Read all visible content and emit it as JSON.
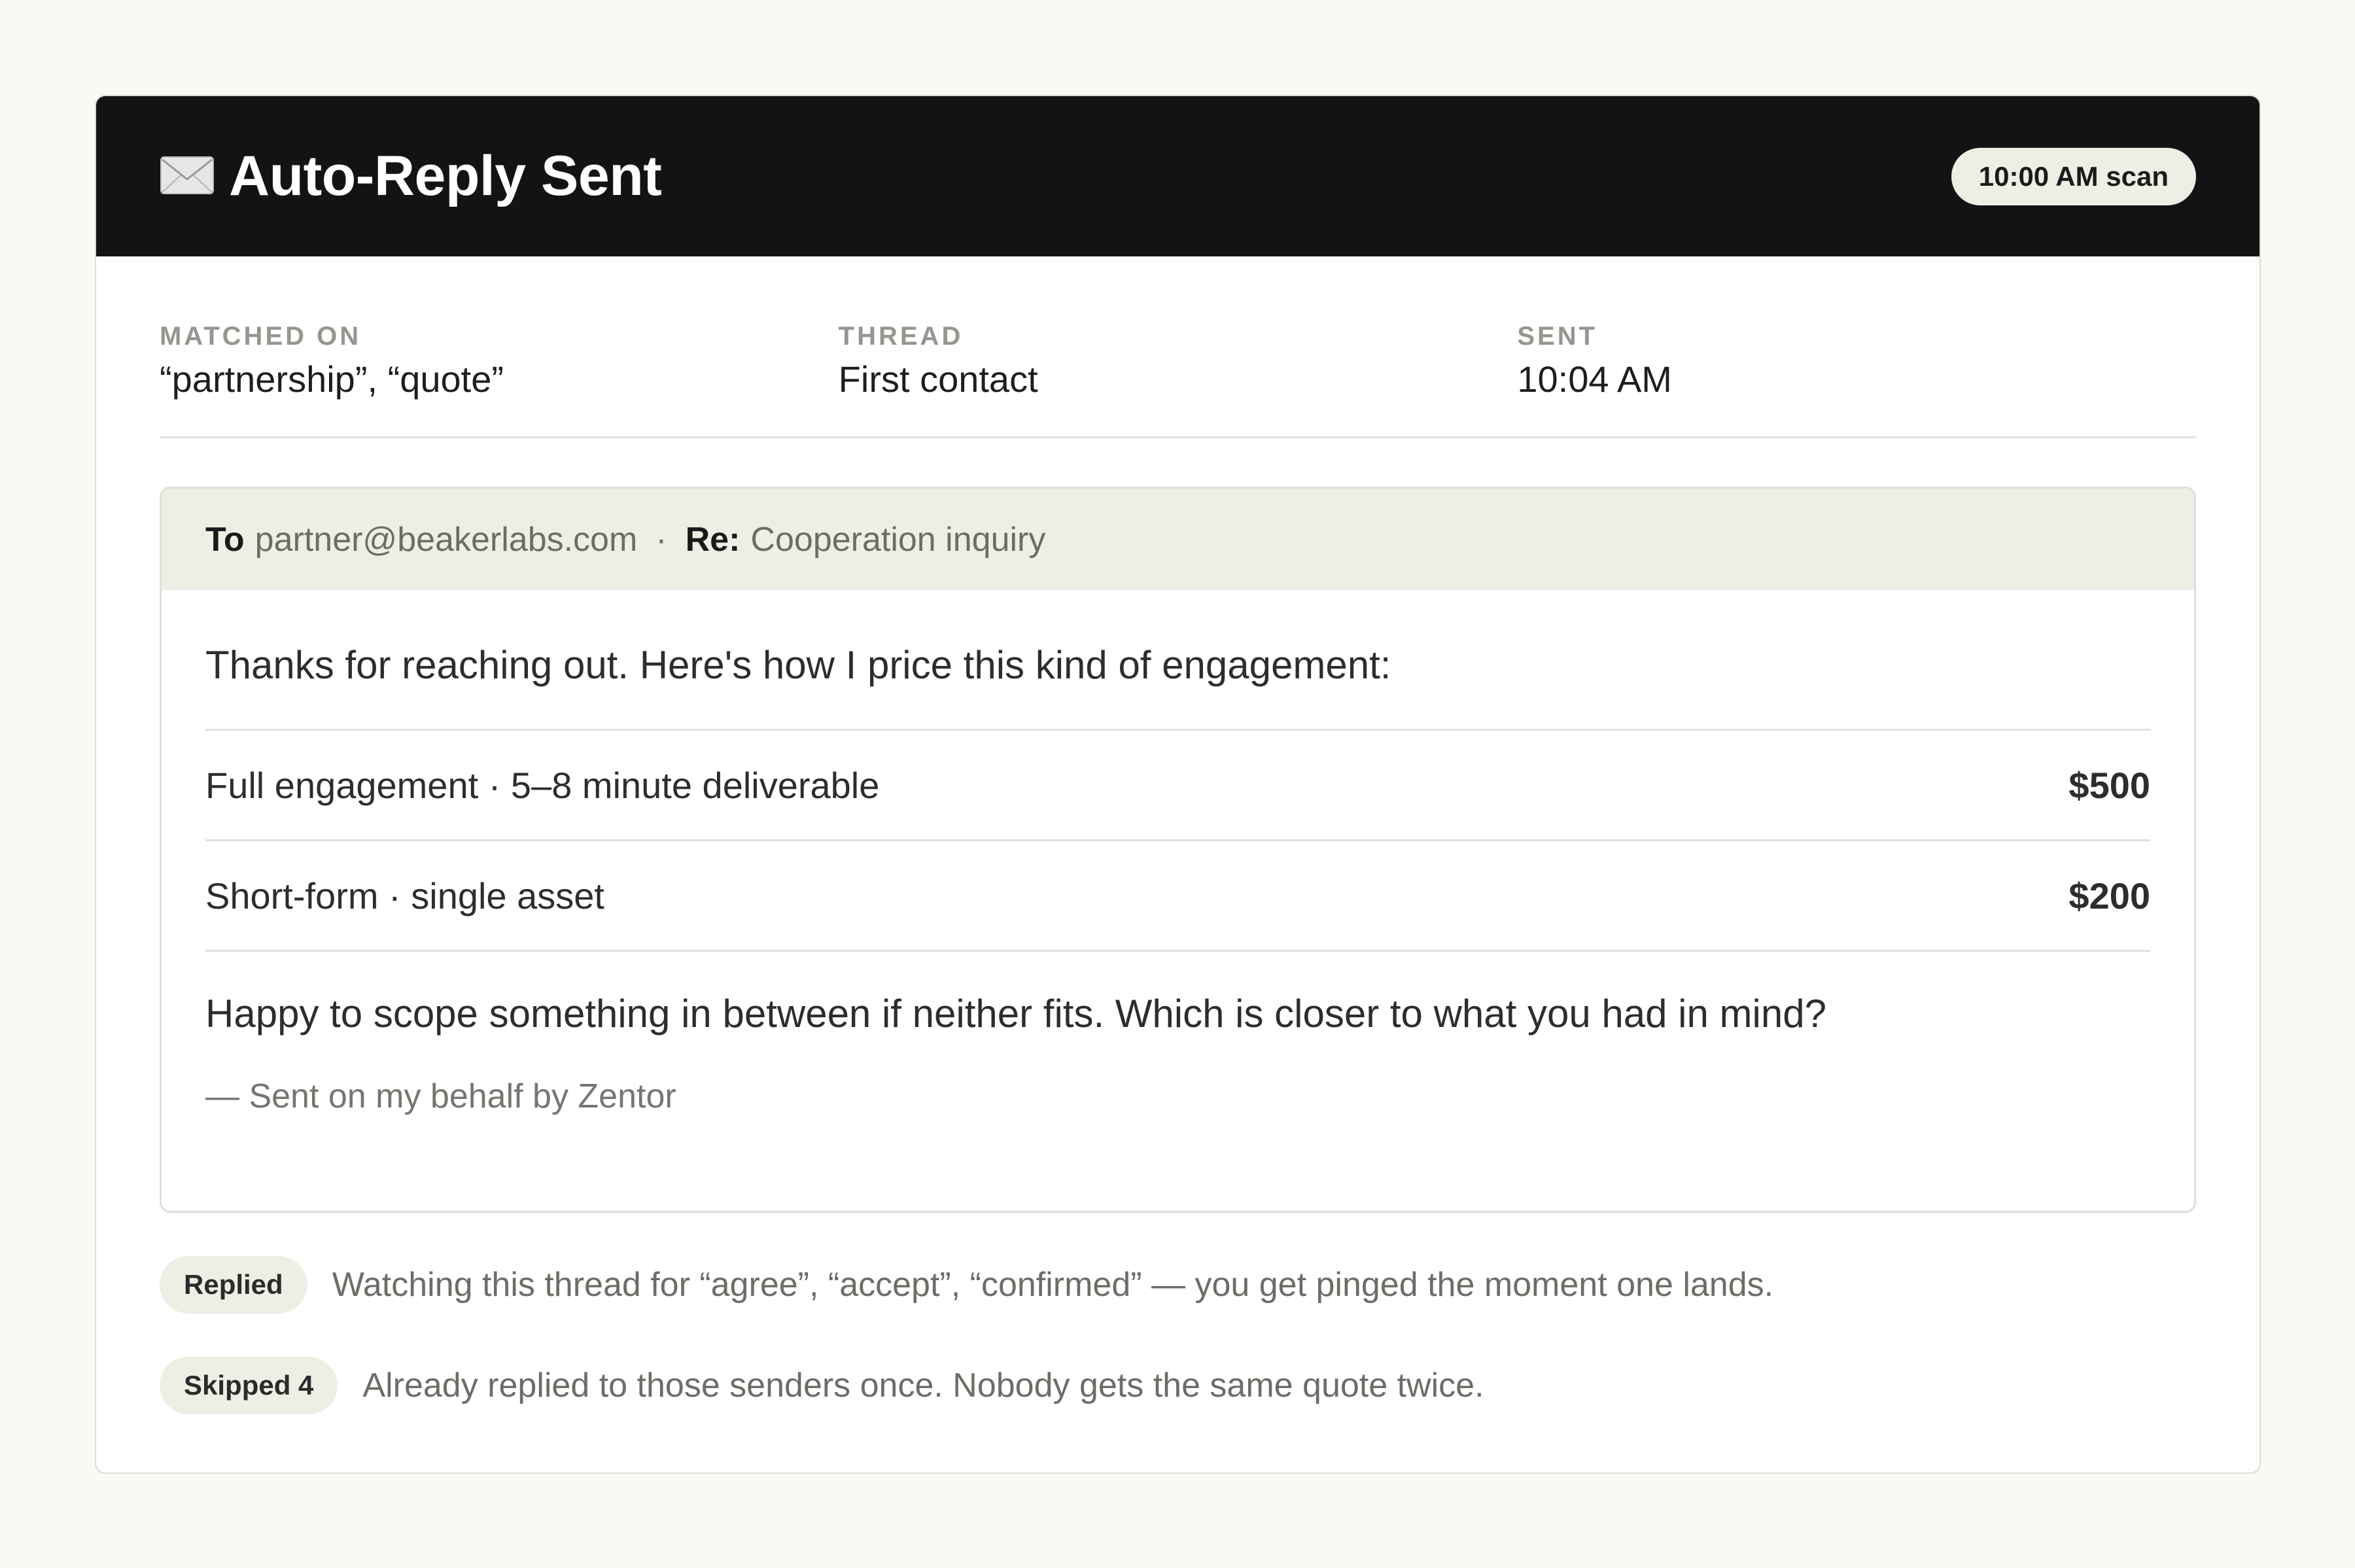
{
  "header": {
    "icon": "envelope-icon",
    "title": "Auto-Reply Sent",
    "scan_badge": "10:00 AM scan"
  },
  "meta": [
    {
      "label": "MATCHED ON",
      "value": "“partnership”, “quote”"
    },
    {
      "label": "THREAD",
      "value": "First contact"
    },
    {
      "label": "SENT",
      "value": "10:04 AM"
    }
  ],
  "email": {
    "to_label": "To",
    "to_address": "partner@beakerlabs.com",
    "separator": "·",
    "re_label": "Re:",
    "subject": "Cooperation inquiry",
    "intro": "Thanks for reaching out. Here's how I price this kind of engagement:",
    "prices": [
      {
        "label": "Full engagement · 5–8 minute deliverable",
        "amount": "$500"
      },
      {
        "label": "Short-form · single asset",
        "amount": "$200"
      }
    ],
    "closing": "Happy to scope something in between if neither fits. Which is closer to what you had in mind?",
    "signature": "— Sent on my behalf by Zentor"
  },
  "status": [
    {
      "pill": "Replied",
      "text": "Watching this thread for “agree”, “accept”, “confirmed” — you get pinged the moment one lands."
    },
    {
      "pill": "Skipped 4",
      "text": "Already replied to those senders once. Nobody gets the same quote twice."
    }
  ],
  "colors": {
    "header_bg": "#131313",
    "page_bg": "#faf9f5",
    "pill_bg": "#efeee4"
  }
}
